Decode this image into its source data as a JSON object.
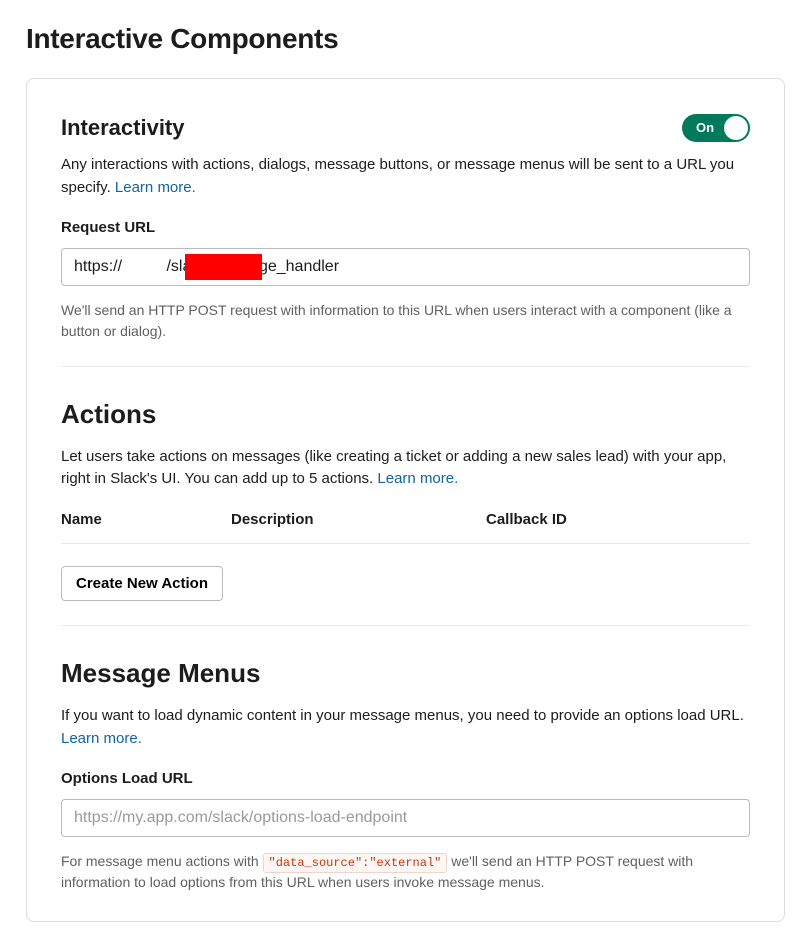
{
  "page": {
    "title": "Interactive Components"
  },
  "interactivity": {
    "heading": "Interactivity",
    "toggle_label": "On",
    "desc": "Any interactions with actions, dialogs, message buttons, or message menus will be sent to a URL you specify. ",
    "learn_more": "Learn more.",
    "request_url_label": "Request URL",
    "request_url_value": "https://          /slack/message_handler",
    "request_url_help": "We'll send an HTTP POST request with information to this URL when users interact with a component (like a button or dialog)."
  },
  "actions": {
    "heading": "Actions",
    "desc": "Let users take actions on messages (like creating a ticket or adding a new sales lead) with your app, right in Slack's UI. You can add up to 5 actions. ",
    "learn_more": "Learn more.",
    "col_name": "Name",
    "col_desc": "Description",
    "col_cb": "Callback ID",
    "create_button": "Create New Action"
  },
  "menus": {
    "heading": "Message Menus",
    "desc": "If you want to load dynamic content in your message menus, you need to provide an options load URL. ",
    "learn_more": "Learn more.",
    "options_url_label": "Options Load URL",
    "options_url_placeholder": "https://my.app.com/slack/options-load-endpoint",
    "help_pre": "For message menu actions with ",
    "help_code": "\"data_source\":\"external\"",
    "help_post": " we'll send an HTTP POST request with information to load options from this URL when users invoke message menus."
  }
}
